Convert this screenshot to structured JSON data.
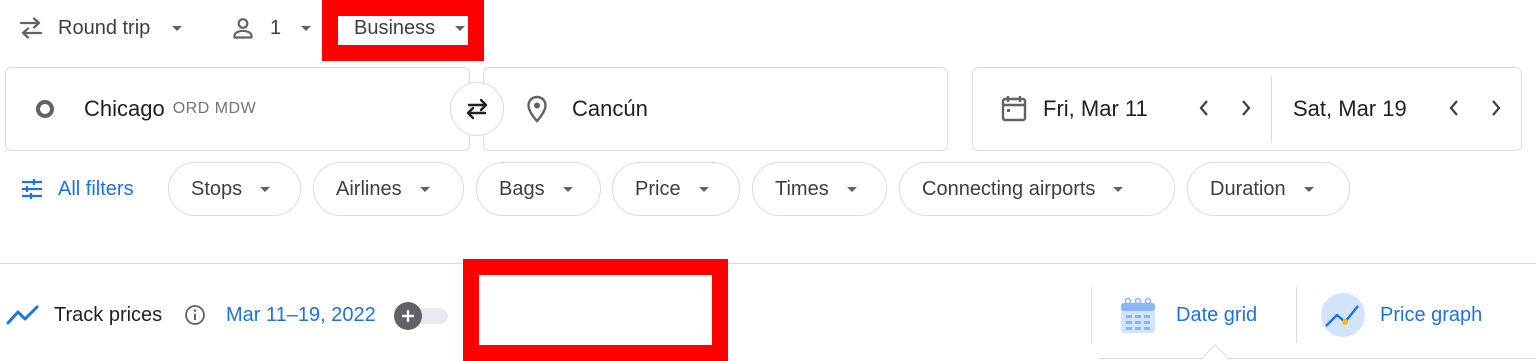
{
  "top_bar": {
    "trip_type": "Round trip",
    "passengers": "1",
    "cabin_class": "Business"
  },
  "search": {
    "origin": "Chicago",
    "origin_codes": "ORD MDW",
    "destination": "Cancún",
    "depart_date": "Fri, Mar 11",
    "return_date": "Sat, Mar 19"
  },
  "filters": {
    "all_filters_label": "All filters",
    "chips": [
      "Stops",
      "Airlines",
      "Bags",
      "Price",
      "Times",
      "Connecting airports",
      "Duration"
    ]
  },
  "tracking": {
    "track_label": "Track prices",
    "date_range": "Mar 11–19, 2022",
    "toggle_on": false
  },
  "views": {
    "date_grid": "Date grid",
    "price_graph": "Price graph"
  },
  "colors": {
    "accent": "#1a73e8",
    "highlight": "#ff0000"
  }
}
